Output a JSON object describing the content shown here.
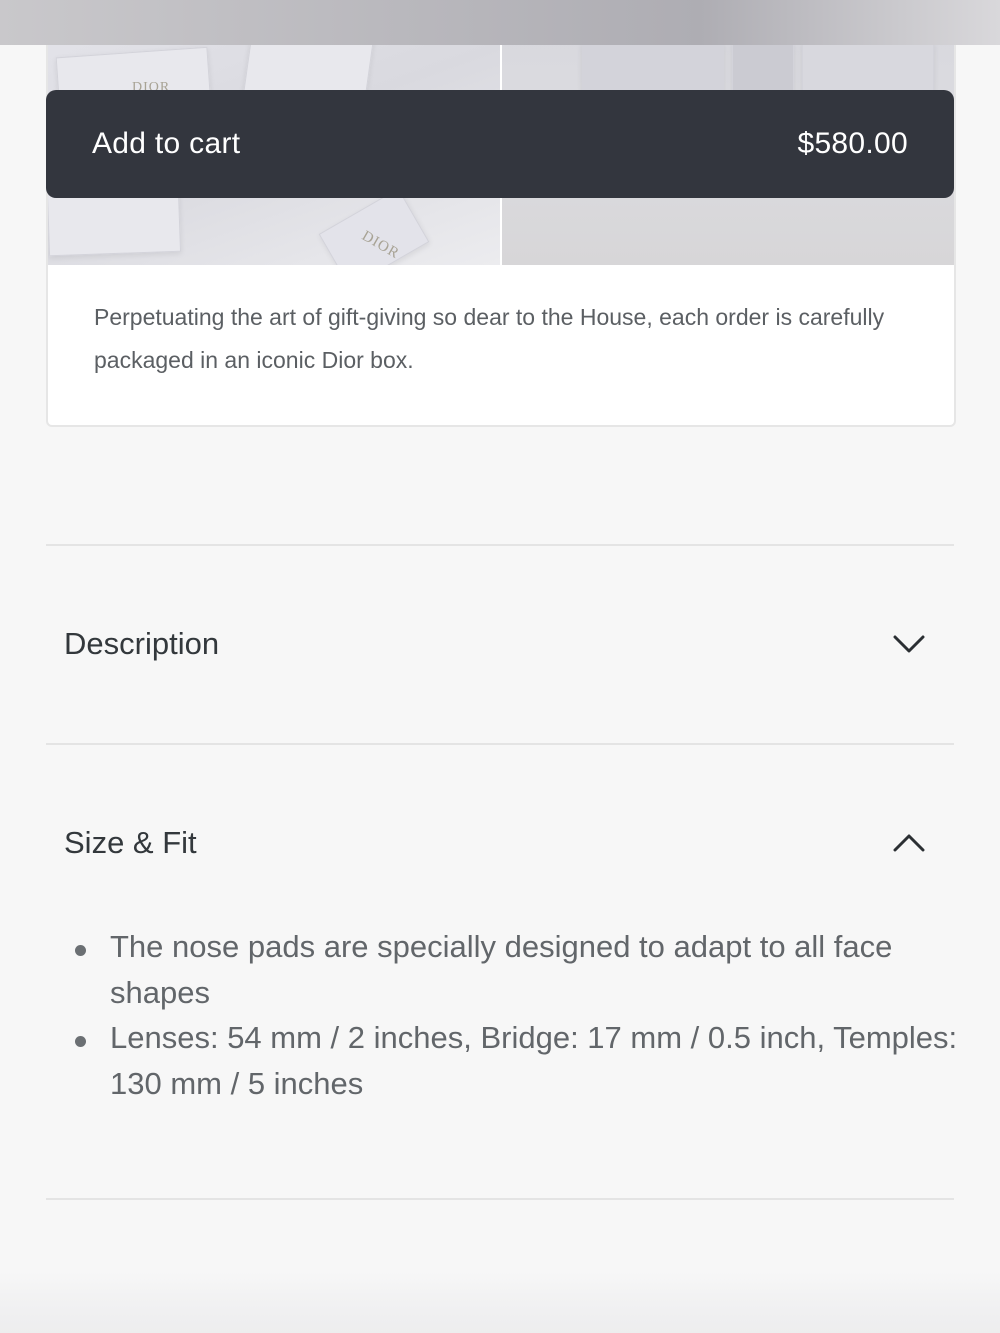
{
  "cart_bar": {
    "label": "Add to cart",
    "price": "$580.00"
  },
  "gift": {
    "image_brand_text": "DIOR",
    "description": "Perpetuating the art of gift-giving so dear to the House, each order is carefully packaged in an iconic Dior box."
  },
  "accordion": {
    "description": {
      "title": "Description",
      "icon": "chevron-down-icon",
      "expanded": false
    },
    "size_fit": {
      "title": "Size & Fit",
      "icon": "chevron-up-icon",
      "expanded": true,
      "items": [
        "The nose pads are specially designed to adapt to all face shapes",
        "Lenses: 54 mm / 2 inches, Bridge: 17 mm / 0.5 inch, Temples: 130 mm / 5 inches"
      ]
    }
  },
  "colors": {
    "cart_bar_bg": "#33363e",
    "cart_bar_text": "#ffffff",
    "page_bg": "#f7f7f7",
    "divider": "#e4e4e4"
  }
}
